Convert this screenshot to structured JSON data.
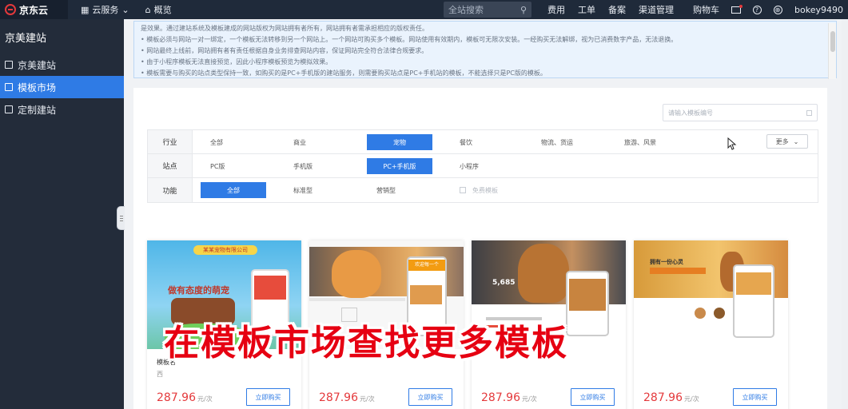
{
  "topbar": {
    "brand": "京东云",
    "cloud_services": "云服务",
    "overview": "概览",
    "search_placeholder": "全站搜索",
    "links": [
      "费用",
      "工单",
      "备案",
      "渠道管理",
      "购物车"
    ],
    "username": "bokey9490"
  },
  "sidebar": {
    "title": "京美建站",
    "items": [
      {
        "label": "京美建站",
        "active": false
      },
      {
        "label": "模板市场",
        "active": true
      },
      {
        "label": "定制建站",
        "active": false
      }
    ]
  },
  "notice": {
    "lines": [
      "是效果。通过建站系统及模板建成的网站版权为网站拥有者所有，网站拥有者需承担相应的版权责任。",
      "• 模板必须与网站一对一绑定，一个模板无法转移到另一个网站上。一个网站可购买多个模板。网站使用有效期内，模板可无限次安装。一经购买无法解绑，视为已消费数字产品，无法退换。",
      "• 网站最终上线前，网站拥有者有责任根据自身业务排查网站内容，保证网站完全符合法律合规要求。",
      "• 由于小程序模板无法直接预览，因此小程序模板预览为模拟效果。",
      "• 模板需要与购买的站点类型保持一致，如购买的是PC+手机版的建站服务，则需要购买站点是PC+手机站的模板，不能选择只是PC版的模板。"
    ]
  },
  "template_search": {
    "placeholder": "请输入模板编号"
  },
  "filters": {
    "industry": {
      "label": "行业",
      "options": [
        "全部",
        "商业",
        "宠物",
        "餐饮",
        "物流、货运",
        "旅游、风景"
      ],
      "selected": "宠物",
      "more": "更多"
    },
    "site": {
      "label": "站点",
      "options": [
        "PC版",
        "手机版",
        "PC+手机版",
        "小程序"
      ],
      "selected": "PC+手机版"
    },
    "function": {
      "label": "功能",
      "options": [
        "全部",
        "标准型",
        "营销型"
      ],
      "selected": "全部",
      "free_label": "免费模板"
    }
  },
  "cards": [
    {
      "name": "模板名",
      "sub": "西",
      "price": "287.96",
      "unit": "元/次",
      "buy": "立即购买",
      "banner": "做有态度的萌宠",
      "company": "某某宠物有限公司"
    },
    {
      "name": "",
      "sub": "",
      "price": "287.96",
      "unit": "元/次",
      "buy": "立即购买",
      "banner": "欢迎每一个"
    },
    {
      "name": "",
      "sub": "",
      "price": "287.96",
      "unit": "元/次",
      "buy": "立即购买",
      "banner": "5,685"
    },
    {
      "name": "",
      "sub": "",
      "price": "287.96",
      "unit": "元/次",
      "buy": "立即购买",
      "banner": "拥有一份心灵"
    }
  ],
  "subtitle": "在模板市场查找更多模板",
  "colors": {
    "accent": "#2f7be5",
    "price": "#e4393c",
    "topbar": "#1f2a3a",
    "sidebar": "#232c3a"
  }
}
